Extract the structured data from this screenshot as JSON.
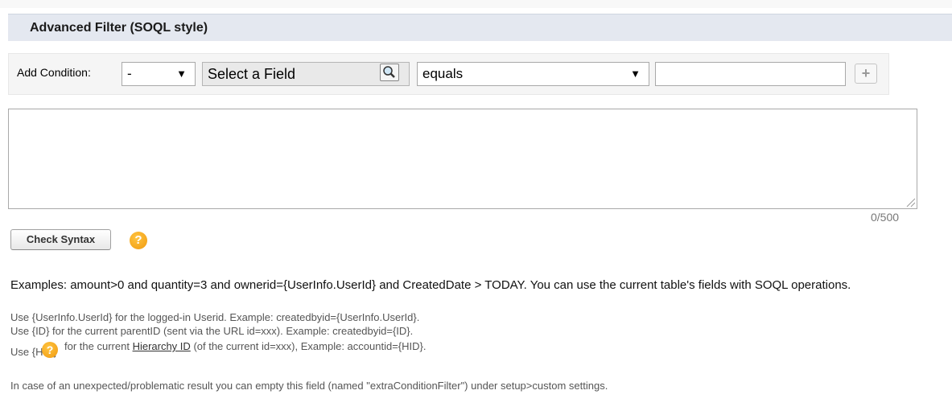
{
  "section": {
    "title": "Advanced Filter (SOQL style)"
  },
  "condition": {
    "label": "Add Condition:",
    "logic_value": "-",
    "field_placeholder": "Select a Field",
    "operator_value": "equals",
    "value": "",
    "add_symbol": "+"
  },
  "icons": {
    "lookup": "magnifier-lookup-icon",
    "add": "plus-icon",
    "help": "question-help-icon",
    "dropdown": "triangle-down-icon"
  },
  "filter": {
    "value": "",
    "counter": "0/500"
  },
  "check_syntax": {
    "label": "Check Syntax"
  },
  "help_symbol": "?",
  "help": {
    "examples": "Examples: amount>0 and quantity=3 and ownerid={UserInfo.UserId} and CreatedDate > TODAY. You can use the current table's fields with SOQL operations.",
    "note_userid": "Use {UserInfo.UserId} for the logged-in Userid. Example: createdbyid={UserInfo.UserId}.",
    "note_id": "Use {ID} for the current parentID (sent via the URL id=xxx). Example: createdbyid={ID}.",
    "note_hid_pre": "Use {HID}",
    "note_hid_mid": "for the current",
    "note_hid_link": "Hierarchy ID",
    "note_hid_post": "(of the current id=xxx), Example: accountid={HID}.",
    "note_reset": "In case of an unexpected/problematic result you can empty this field (named \"extraConditionFilter\") under setup>custom settings."
  },
  "colors": {
    "header_bg": "#e4e8f0",
    "condition_bg": "#f5f5f5",
    "help_icon": "#f5a623"
  }
}
